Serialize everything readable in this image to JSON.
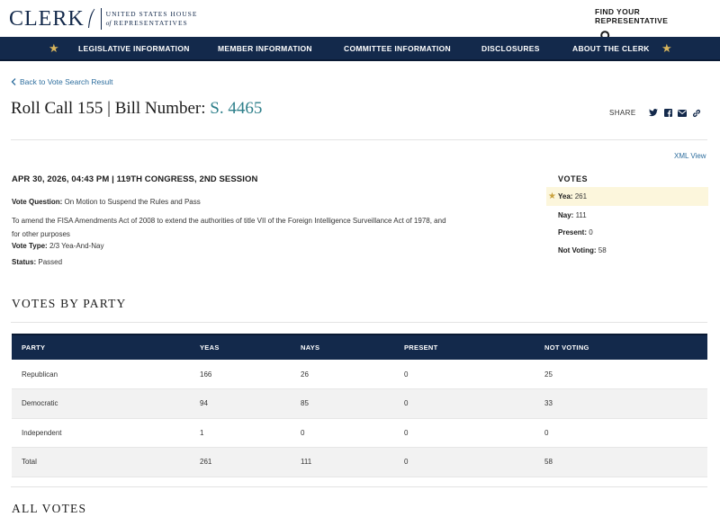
{
  "header": {
    "logo_word": "CLERK",
    "logo_line1": "UNITED STATES HOUSE",
    "logo_of": "of",
    "logo_line2": "REPRESENTATIVES",
    "find_rep_label": "FIND YOUR REPRESENTATIVE"
  },
  "nav": {
    "items": [
      "LEGISLATIVE INFORMATION",
      "MEMBER INFORMATION",
      "COMMITTEE INFORMATION",
      "DISCLOSURES",
      "ABOUT THE CLERK"
    ]
  },
  "back_link": "Back to Vote Search Result",
  "title": {
    "prefix": "Roll Call 155 | Bill Number: ",
    "bill": "S. 4465"
  },
  "share_label": "SHARE",
  "xml_view": "XML View",
  "vote": {
    "date": "APR 30, 2026, 04:43 PM | 119TH CONGRESS, 2ND SESSION",
    "question_label": "Vote Question:",
    "question": "On Motion to Suspend the Rules and Pass",
    "description": "To amend the FISA Amendments Act of 2008 to extend the authorities of title VII of the Foreign Intelligence Surveillance Act of 1978, and for other purposes",
    "type_label": "Vote Type:",
    "type": "2/3 Yea-And-Nay",
    "status_label": "Status:",
    "status": "Passed"
  },
  "votes_summary": {
    "title": "VOTES",
    "yea_label": "Yea:",
    "yea": "261",
    "nay_label": "Nay:",
    "nay": "111",
    "present_label": "Present:",
    "present": "0",
    "not_voting_label": "Not Voting:",
    "not_voting": "58"
  },
  "votes_by_party": {
    "heading": "VOTES BY PARTY",
    "columns": [
      "PARTY",
      "YEAS",
      "NAYS",
      "PRESENT",
      "NOT VOTING"
    ],
    "rows": [
      [
        "Republican",
        "166",
        "26",
        "0",
        "25"
      ],
      [
        "Democratic",
        "94",
        "85",
        "0",
        "33"
      ],
      [
        "Independent",
        "1",
        "0",
        "0",
        "0"
      ],
      [
        "Total",
        "261",
        "111",
        "0",
        "58"
      ]
    ]
  },
  "all_votes_heading": "ALL VOTES",
  "colors": {
    "navy": "#13294b",
    "gold": "#d8b55c",
    "link": "#2e6e9e",
    "bill_teal": "#2e7f8a",
    "highlight": "#fcf6dc"
  }
}
